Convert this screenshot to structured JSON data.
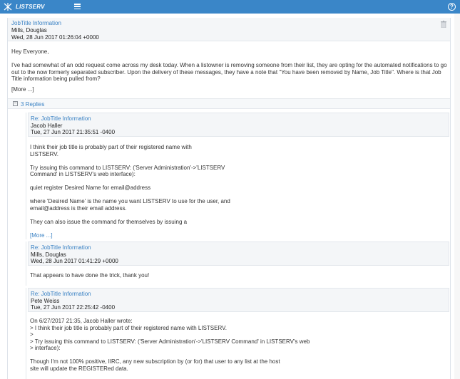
{
  "header": {
    "brand": "LISTSERV"
  },
  "message": {
    "subject": "JobTitle Information",
    "author": "Mills, Douglas",
    "date": "Wed, 28 Jun 2017 01:26:04 +0000",
    "greeting": "Hey Everyone,",
    "body": "I've had somewhat of an odd request come across my desk today. When a listowner is removing someone from their list, they are opting for the automated notifications to go out to the now formerly separated subscriber. Upon the delivery of these messages, they have a note that \"You have been removed by Name, Job Title\". Where is that Job Title information being pulled from?",
    "more": "[More ...]"
  },
  "replies_label": "3 Replies",
  "replies": [
    {
      "subject": "Re: JobTitle Information",
      "author": "Jacob Haller",
      "date": "Tue, 27 Jun 2017 21:35:51 -0400",
      "lines": [
        "I think their job title is probably part of their registered name with",
        "LISTSERV.",
        "",
        "Try issuing this command to LISTSERV: ('Server Administration'->'LISTSERV",
        "Command' in LISTSERV's web interface):",
        "",
        "quiet register Desired Name for email@address",
        "",
        "where 'Desired Name' is the name you want LISTSERV to use for the user, and",
        "email@address is their email address.",
        "",
        "They can also issue the command for themselves by issuing a"
      ],
      "more": "[More ...]"
    },
    {
      "subject": "Re: JobTitle Information",
      "author": "Mills, Douglas",
      "date": "Wed, 28 Jun 2017 01:41:29 +0000",
      "lines": [
        "That appears to have done the trick, thank you!"
      ]
    },
    {
      "subject": "Re: JobTitle Information",
      "author": "Pete Weiss",
      "date": "Tue, 27 Jun 2017 22:25:42 -0400",
      "lines": [
        "On 6/27/2017 21:35, Jacob Haller wrote:",
        "> I think their job title is probably part of their registered name with LISTSERV.",
        ">",
        "> Try issuing this command to LISTSERV: ('Server Administration'->'LISTSERV Command' in LISTSERV's web",
        "> interface):",
        "",
        "Though I'm not 100% positive, IIRC, any new subscription by (or for) that user to any list at the host",
        "site will update the REGISTERed data."
      ]
    }
  ]
}
